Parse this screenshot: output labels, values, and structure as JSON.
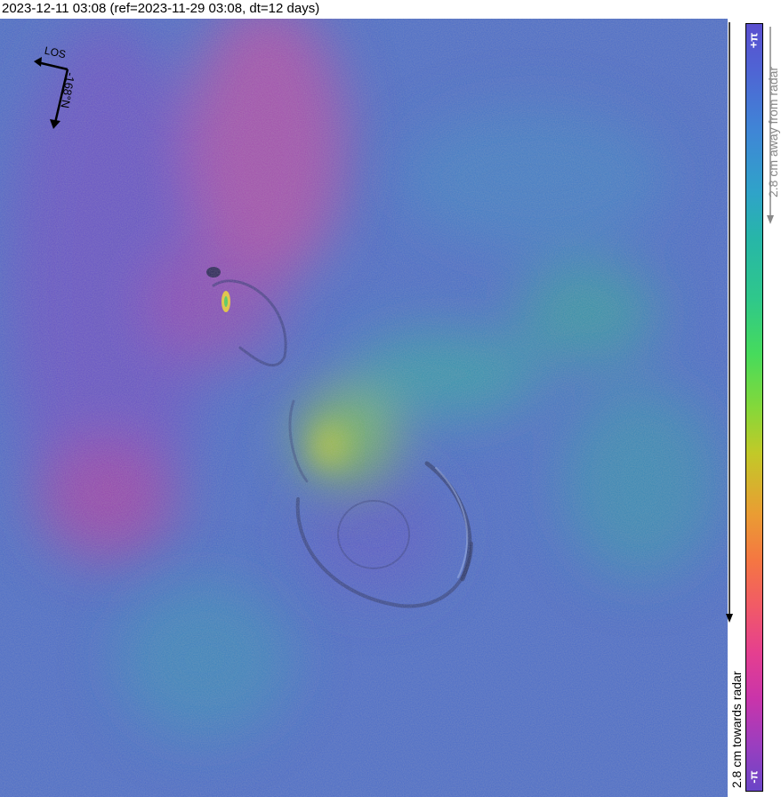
{
  "title": "2023-12-11 03:08 (ref=2023-11-29 03:08, dt=12 days)",
  "compass": {
    "los_label": "LOS",
    "heading_label": "-168°N",
    "icon": "north-arrow-icon"
  },
  "colorbar": {
    "top_label": "+π",
    "bottom_label": "-π",
    "away_label": "2.8 cm away from radar",
    "toward_label": "2.8 cm towards radar",
    "colors": [
      "#5a4fcf",
      "#3f86d6",
      "#27b6a8",
      "#46db5c",
      "#c2c928",
      "#f57642",
      "#e53f8f",
      "#6a45c7"
    ]
  }
}
